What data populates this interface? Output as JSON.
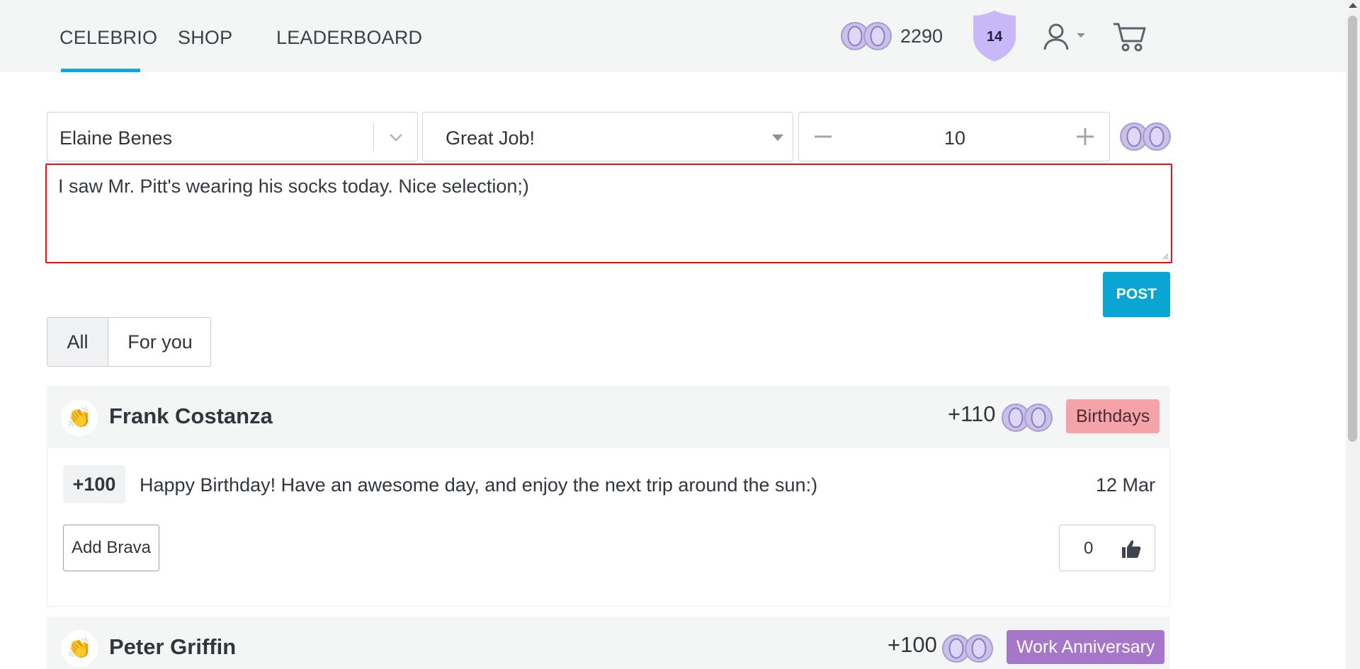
{
  "nav": {
    "links": [
      "CELEBRIO",
      "SHOP",
      "LEADERBOARD"
    ],
    "active_link": "CELEBRIO",
    "points": "2290",
    "level": "14",
    "icons": [
      "coins-icon",
      "level-shield-icon",
      "user-icon",
      "caret-down-icon",
      "cart-icon"
    ]
  },
  "compose": {
    "recipient": "Elaine Benes",
    "reason": "Great Job!",
    "amount": "10",
    "message": "I saw Mr. Pitt's wearing his socks today.  Nice selection;)",
    "post_label": "POST"
  },
  "filters": {
    "tabs": [
      "All",
      "For you"
    ],
    "active": "All"
  },
  "feed": [
    {
      "name": "Frank Costanza",
      "points": "+110",
      "tag": "Birthdays",
      "entry": {
        "points": "+100",
        "message": "Happy Birthday! Have an awesome day, and enjoy the next trip around the sun:)",
        "date": "12 Mar"
      },
      "brava_label": "Add Brava",
      "likes": "0"
    },
    {
      "name": "Peter Griffin",
      "points": "+100",
      "tag": "Work Anniversary"
    }
  ],
  "colors": {
    "accent": "#0aa5d2",
    "error_border": "#e8111b",
    "birthday_tag": "#f5a3ab",
    "anniversary_tag": "#a676c8",
    "level_badge": "#c8b8f8"
  }
}
